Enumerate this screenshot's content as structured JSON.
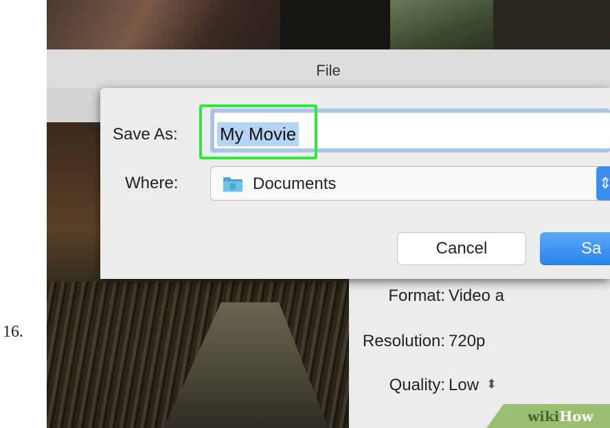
{
  "step_number": "16.",
  "window": {
    "title": "File"
  },
  "dialog": {
    "save_as_label": "Save As:",
    "save_as_value": "My Movie",
    "where_label": "Where:",
    "where_value": "Documents",
    "cancel_label": "Cancel",
    "save_label": "Sa"
  },
  "settings": {
    "format_label": "Format:",
    "format_value": "Video a",
    "resolution_label": "Resolution:",
    "resolution_value": "720p",
    "quality_label": "Quality:",
    "quality_value": "Low"
  },
  "watermark": {
    "wiki": "wiki",
    "how": "How"
  },
  "colors": {
    "highlight": "#2fe63c",
    "primary_button": "#2a84ef",
    "selection": "#b4d3f5"
  }
}
